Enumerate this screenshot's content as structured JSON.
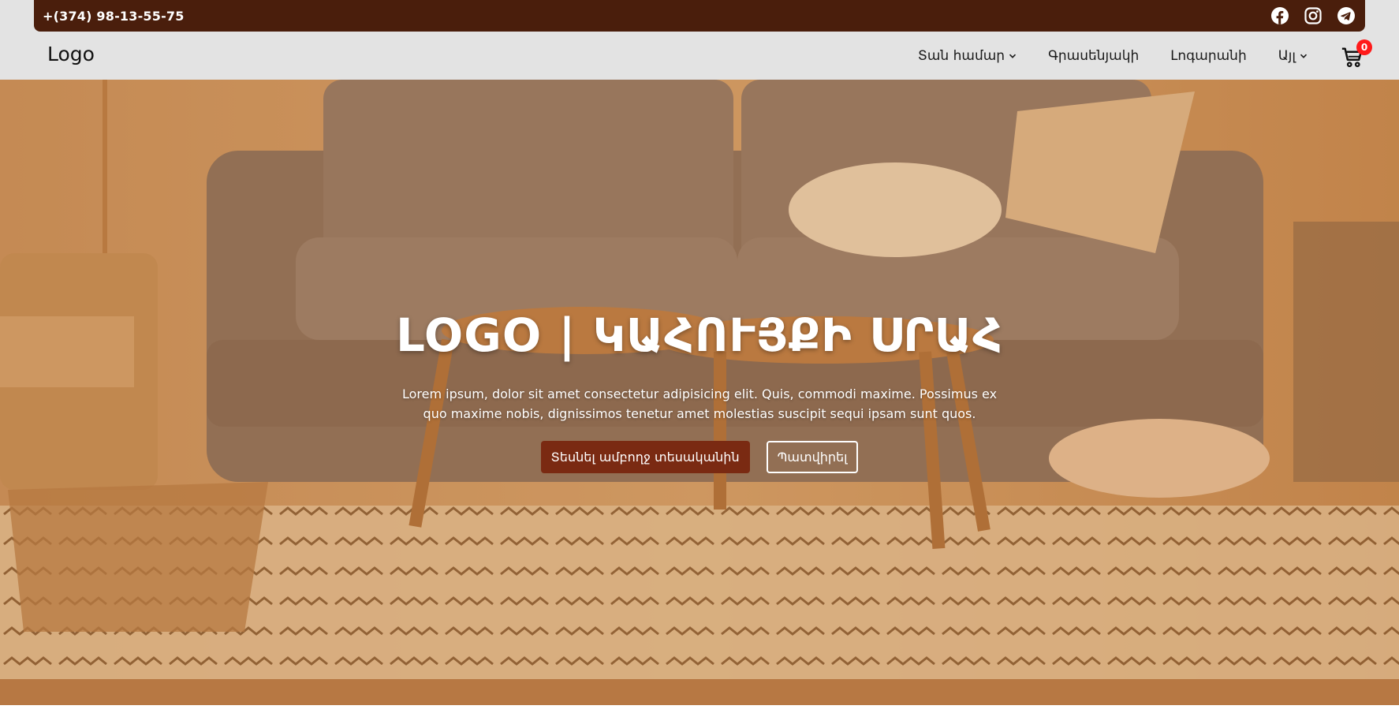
{
  "topbar": {
    "phone": "+(374) 98-13-55-75",
    "socials": [
      {
        "icon": "facebook-icon"
      },
      {
        "icon": "instagram-icon"
      },
      {
        "icon": "telegram-icon"
      }
    ],
    "background": "#4a1e0c"
  },
  "navbar": {
    "logo": "Logo",
    "items": [
      {
        "label": "Տան համար",
        "dropdown": true
      },
      {
        "label": "Գրասենյակի",
        "dropdown": false
      },
      {
        "label": "Լոգարանի",
        "dropdown": false
      },
      {
        "label": "Այլ",
        "dropdown": true
      }
    ],
    "cart": {
      "icon": "cart-icon",
      "count": "0"
    }
  },
  "hero": {
    "title": "LOGO | ԿԱՀՈՒՅՔԻ ՍՐԱՀ",
    "text": "Lorem ipsum, dolor sit amet consectetur adipisicing elit. Quis, commodi maxime. Possimus ex quo maxime nobis, dignissimos tenetur amet molestias suscipit sequi ipsam sunt quos.",
    "primary_button": "Տեսնել ամբողջ տեսականին",
    "secondary_button": "Պատվիրել",
    "accent": "#7a2a12"
  }
}
